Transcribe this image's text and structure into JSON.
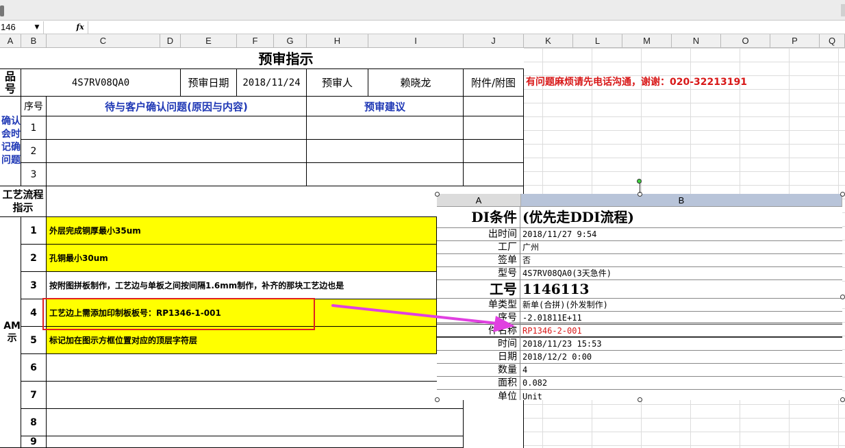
{
  "formula_bar": {
    "name_box": "146",
    "fx_label": "fx",
    "formula": ""
  },
  "columns": [
    "A",
    "B",
    "C",
    "D",
    "E",
    "F",
    "G",
    "H",
    "I",
    "J",
    "K",
    "L",
    "M",
    "N",
    "O",
    "P",
    "Q"
  ],
  "sheet": {
    "title": "预审指示",
    "row1": {
      "label": "品\n号",
      "part_no": "4S7RV08QA0",
      "date_label": "预审日期",
      "date_value": "2018/11/24",
      "reviewer_label": "预审人",
      "reviewer_name": "赖晓龙",
      "attach_label": "附件/附图",
      "note": "有问题麻烦请先电话沟通，谢谢：020-32213191"
    },
    "confirm": {
      "side_label": "确认\n会时\n记确\n问题",
      "seq_header": "序号",
      "issue_header": "待与客户确认问题(原因与内容)",
      "advice_header": "预审建议",
      "rows": [
        "1",
        "2",
        "3"
      ]
    },
    "process": {
      "side_label": "工艺流程\n指示",
      "cam_label": "AM\n示",
      "steps": [
        {
          "no": "1",
          "text": "外层完成铜厚最小35um"
        },
        {
          "no": "2",
          "text": "孔铜最小30um"
        },
        {
          "no": "3",
          "text": "按附图拼板制作，工艺边与单板之间按间隔1.6mm制作，补齐的那块工艺边也是"
        },
        {
          "no": "4",
          "text": "工艺边上需添加印制板板号：RP1346-1-001"
        },
        {
          "no": "5",
          "text": "标记加在图示方框位置对应的顶层字符层"
        },
        {
          "no": "6",
          "text": ""
        },
        {
          "no": "7",
          "text": ""
        },
        {
          "no": "8",
          "text": ""
        },
        {
          "no": "9",
          "text": ""
        }
      ]
    }
  },
  "overlay": {
    "col_a": "A",
    "col_b": "B",
    "header_label": "DI条件",
    "header_value": "(优先走DDI流程)",
    "rows": [
      {
        "label": "出时间",
        "value": "2018/11/27 9:54"
      },
      {
        "label": "工厂",
        "value": "广州"
      },
      {
        "label": "签单",
        "value": "否"
      },
      {
        "label": "型号",
        "value": "4S7RV08QA0(3天急件)"
      },
      {
        "label": "工号",
        "value": "1146113"
      },
      {
        "label": "单类型",
        "value": "新单(合拼)(外发制作)"
      },
      {
        "label": "序号",
        "value": "-2.01811E+11"
      },
      {
        "label": "件名称",
        "value": "RP1346-2-001"
      },
      {
        "label": "时间",
        "value": "2018/11/23 15:53"
      },
      {
        "label": "日期",
        "value": "2018/12/2 0:00"
      },
      {
        "label": "数量",
        "value": "4"
      },
      {
        "label": "面积",
        "value": "0.082"
      },
      {
        "label": "单位",
        "value": "Unit"
      }
    ]
  },
  "colors": {
    "highlight": "#ffff00",
    "blue_text": "#1f38b5",
    "red_text": "#d81818",
    "box": "#e02020",
    "arrow": "#e040e0"
  }
}
